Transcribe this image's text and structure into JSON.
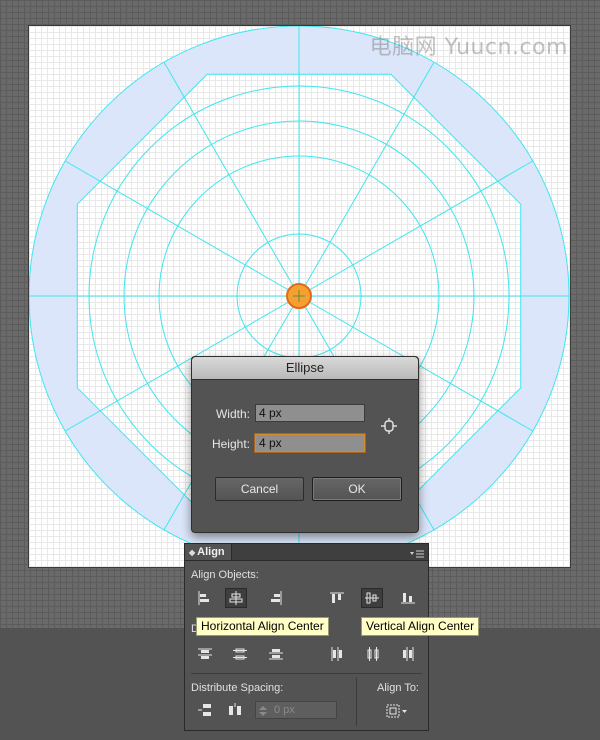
{
  "watermark": "电脑网 Yuucn.com",
  "canvas": {
    "guide_color": "#3fe6ef",
    "band_fill": "#dbe6fa",
    "center_dot_fill": "#f5a030",
    "center_dot_stroke": "#e06a20"
  },
  "ellipse_dialog": {
    "title": "Ellipse",
    "width_label": "Width:",
    "width_value": "4 px",
    "height_label": "Height:",
    "height_value": "4 px",
    "constrain_icon": "link-chain-icon",
    "cancel_label": "Cancel",
    "ok_label": "OK"
  },
  "align_panel": {
    "tab_label": "Align",
    "align_objects_label": "Align Objects:",
    "distribute_objects_label": "D",
    "distribute_spacing_label": "Distribute Spacing:",
    "align_to_label": "Align To:",
    "spacing_value": "0 px",
    "align_objects_buttons": [
      "horizontal-align-left-icon",
      "horizontal-align-center-icon",
      "horizontal-align-right-icon",
      "vertical-align-top-icon",
      "vertical-align-center-icon",
      "vertical-align-bottom-icon"
    ],
    "pressed": [
      "horizontal-align-center-icon",
      "vertical-align-center-icon"
    ]
  },
  "tooltips": {
    "horizontal": "Horizontal Align Center",
    "vertical": "Vertical Align Center"
  }
}
